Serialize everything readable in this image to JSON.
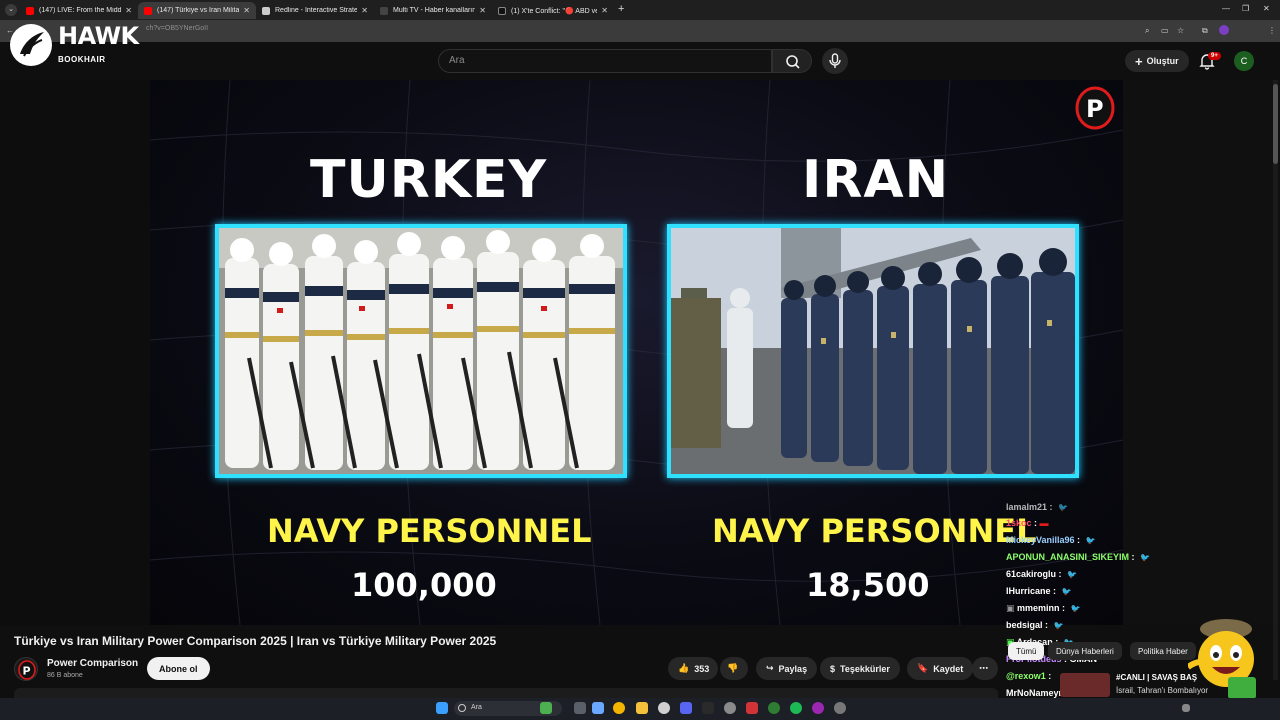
{
  "browser": {
    "tabs": [
      {
        "label": "(147) LIVE: From the Middle Ea",
        "color": "#ff0000",
        "active": false
      },
      {
        "label": "(147) Türkiye vs Iran Military Po",
        "color": "#ff0000",
        "active": true
      },
      {
        "label": "Redline - Interactive Strategic M",
        "color": "#cccccc",
        "active": false
      },
      {
        "label": "Multi TV - Haber kanallarını ay",
        "color": "#444444",
        "active": false
      },
      {
        "label": "(1) X'te Conflict: \"🔴 ABD ve İsr",
        "color": "#222222",
        "active": false
      }
    ],
    "new_tab": "+",
    "url": "ch?v=OB5YNerGoII"
  },
  "overlay_logo": {
    "text": "HAWK",
    "subtitle": "BOOKHAIR"
  },
  "header": {
    "search_placeholder": "Ara",
    "create_label": "Oluştur",
    "notif_count": "9+",
    "user_initial": "C"
  },
  "video": {
    "left_country": "TURKEY",
    "right_country": "IRAN",
    "left_stat_label": "NAVY PERSONNEL",
    "right_stat_label": "NAVY PERSONNEL",
    "left_stat_value": "100,000",
    "right_stat_value": "18,500",
    "frame_color": "#30e0ff",
    "label_color": "#fff44a"
  },
  "chat": [
    {
      "user": "lamalm21",
      "msg": "",
      "color": "#ffffff"
    },
    {
      "user": "1skoc",
      "msg": "",
      "color": "#ff4d6d"
    },
    {
      "user": "MickeyVanilla96",
      "msg": "",
      "color": "#9ad0ff"
    },
    {
      "user": "APONUN_ANASINI_SIKEYIM",
      "msg": "",
      "color": "#8cff6a"
    },
    {
      "user": "61cakiroglu",
      "msg": "",
      "color": "#ffffff"
    },
    {
      "user": "IHurricane",
      "msg": "",
      "color": "#ffffff"
    },
    {
      "user": "mmeminn",
      "msg": "",
      "color": "#ffffff"
    },
    {
      "user": "bedsigal",
      "msg": "",
      "color": "#ffffff"
    },
    {
      "user": "Ardacan",
      "msg": "",
      "color": "#ffffff"
    },
    {
      "user": "ProPilotdeus",
      "msg": "GMAN",
      "color": "#c58bff"
    },
    {
      "user": "@rexow1",
      "msg": "",
      "color": "#8cff6a"
    },
    {
      "user": "MrNoNameyms",
      "msg": "",
      "color": "#ffffff"
    }
  ],
  "chips": [
    {
      "label": "Tümü",
      "selected": true
    },
    {
      "label": "Dünya Haberleri",
      "selected": false
    },
    {
      "label": "Politika Haber",
      "selected": false
    }
  ],
  "news_ticker": {
    "line1": "#CANLI | SAVAŞ BAŞ",
    "line2": "İsrail, Tahran'ı Bombalıyor"
  },
  "video_info": {
    "title": "Türkiye vs Iran Military Power Comparison 2025 | Iran vs Türkiye Military Power 2025",
    "channel": "Power Comparison",
    "subscribers": "86 B abone",
    "subscribe_label": "Abone ol",
    "likes": "353",
    "share_label": "Paylaş",
    "thanks_label": "Teşekkürler",
    "save_label": "Kaydet"
  },
  "taskbar": {
    "search_placeholder": "Ara"
  }
}
